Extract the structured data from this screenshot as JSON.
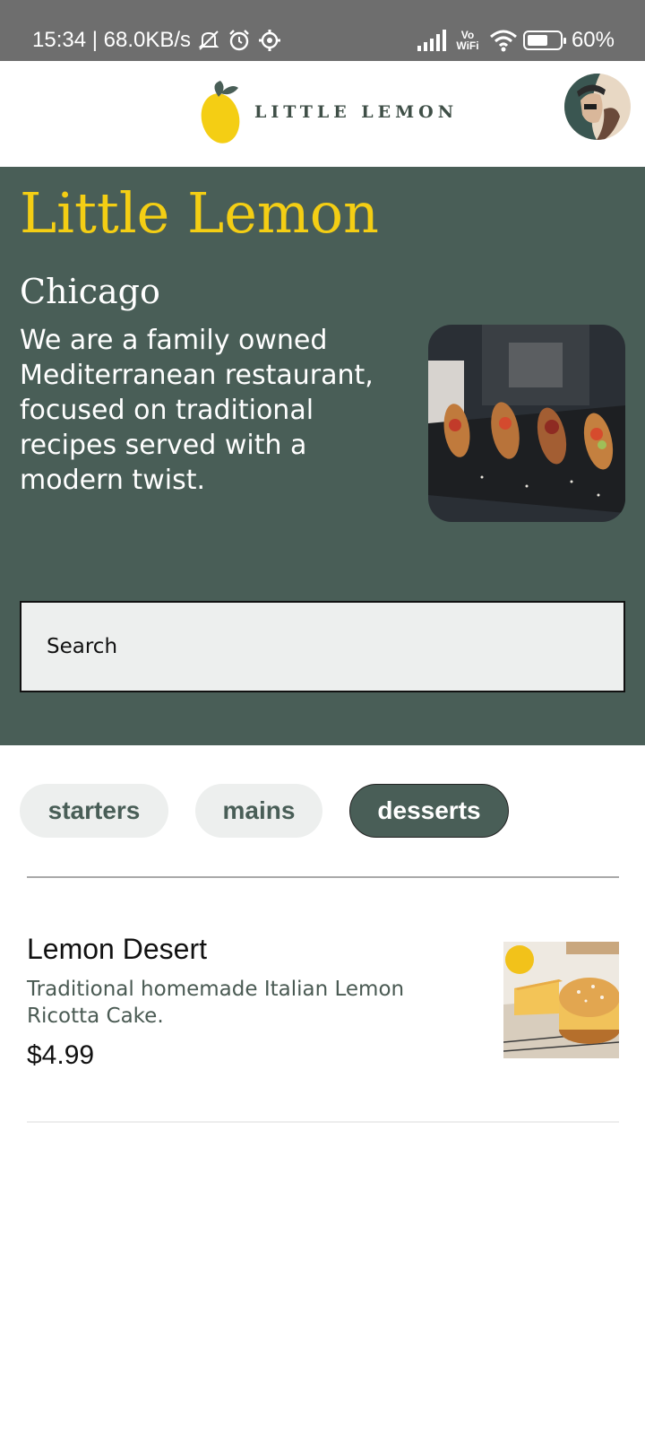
{
  "status_bar": {
    "time_speed": "15:34 | 68.0KB/s",
    "vowifi_top": "Vo",
    "vowifi_bottom": "WiFi",
    "battery": "60%",
    "icons": [
      "mute-icon",
      "alarm-icon",
      "settings-icon",
      "signal-icon",
      "vowifi-icon",
      "wifi-icon",
      "battery-icon"
    ]
  },
  "header": {
    "logo_text": "LITTLE LEMON"
  },
  "hero": {
    "title": "Little Lemon",
    "city": "Chicago",
    "description": "We are a family owned Mediterranean restaurant, focused on traditional recipes served with a modern twist.",
    "search_placeholder": "Search"
  },
  "categories": [
    {
      "label": "starters",
      "active": false
    },
    {
      "label": "mains",
      "active": false
    },
    {
      "label": "desserts",
      "active": true
    }
  ],
  "menu": [
    {
      "name": "Lemon Desert",
      "description": "Traditional homemade Italian Lemon Ricotta Cake.",
      "price": "$4.99"
    }
  ],
  "colors": {
    "primary_green": "#495e57",
    "primary_yellow": "#f4ce14",
    "light_gray": "#edefee"
  }
}
